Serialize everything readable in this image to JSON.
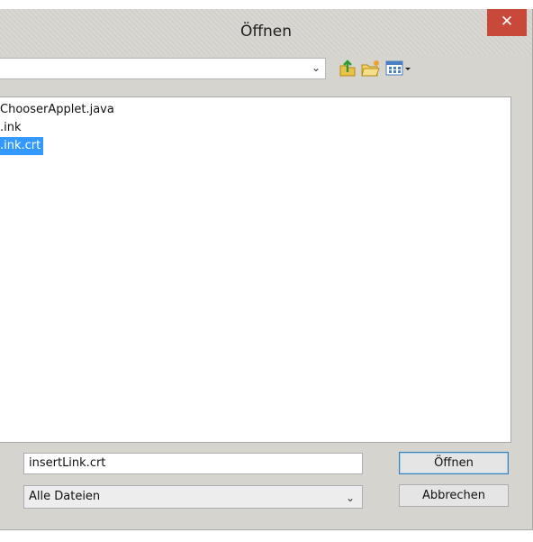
{
  "window": {
    "title": "Öffnen",
    "close_label": "✕"
  },
  "toolbar": {
    "path_value": "",
    "icons": [
      "up-folder-icon",
      "new-folder-icon",
      "view-menu-icon"
    ]
  },
  "file_list": {
    "items": [
      {
        "label": "ChooserApplet.java",
        "selected": false
      },
      {
        "label": ".ink",
        "selected": false
      },
      {
        "label": ".ink.crt",
        "selected": true
      }
    ]
  },
  "bottom": {
    "filename_value": "insertLink.crt",
    "filetype_value": "Alle Dateien",
    "open_label": "Öffnen",
    "cancel_label": "Abbrechen"
  },
  "colors": {
    "selection": "#3399ff",
    "close_button": "#c8483a"
  }
}
